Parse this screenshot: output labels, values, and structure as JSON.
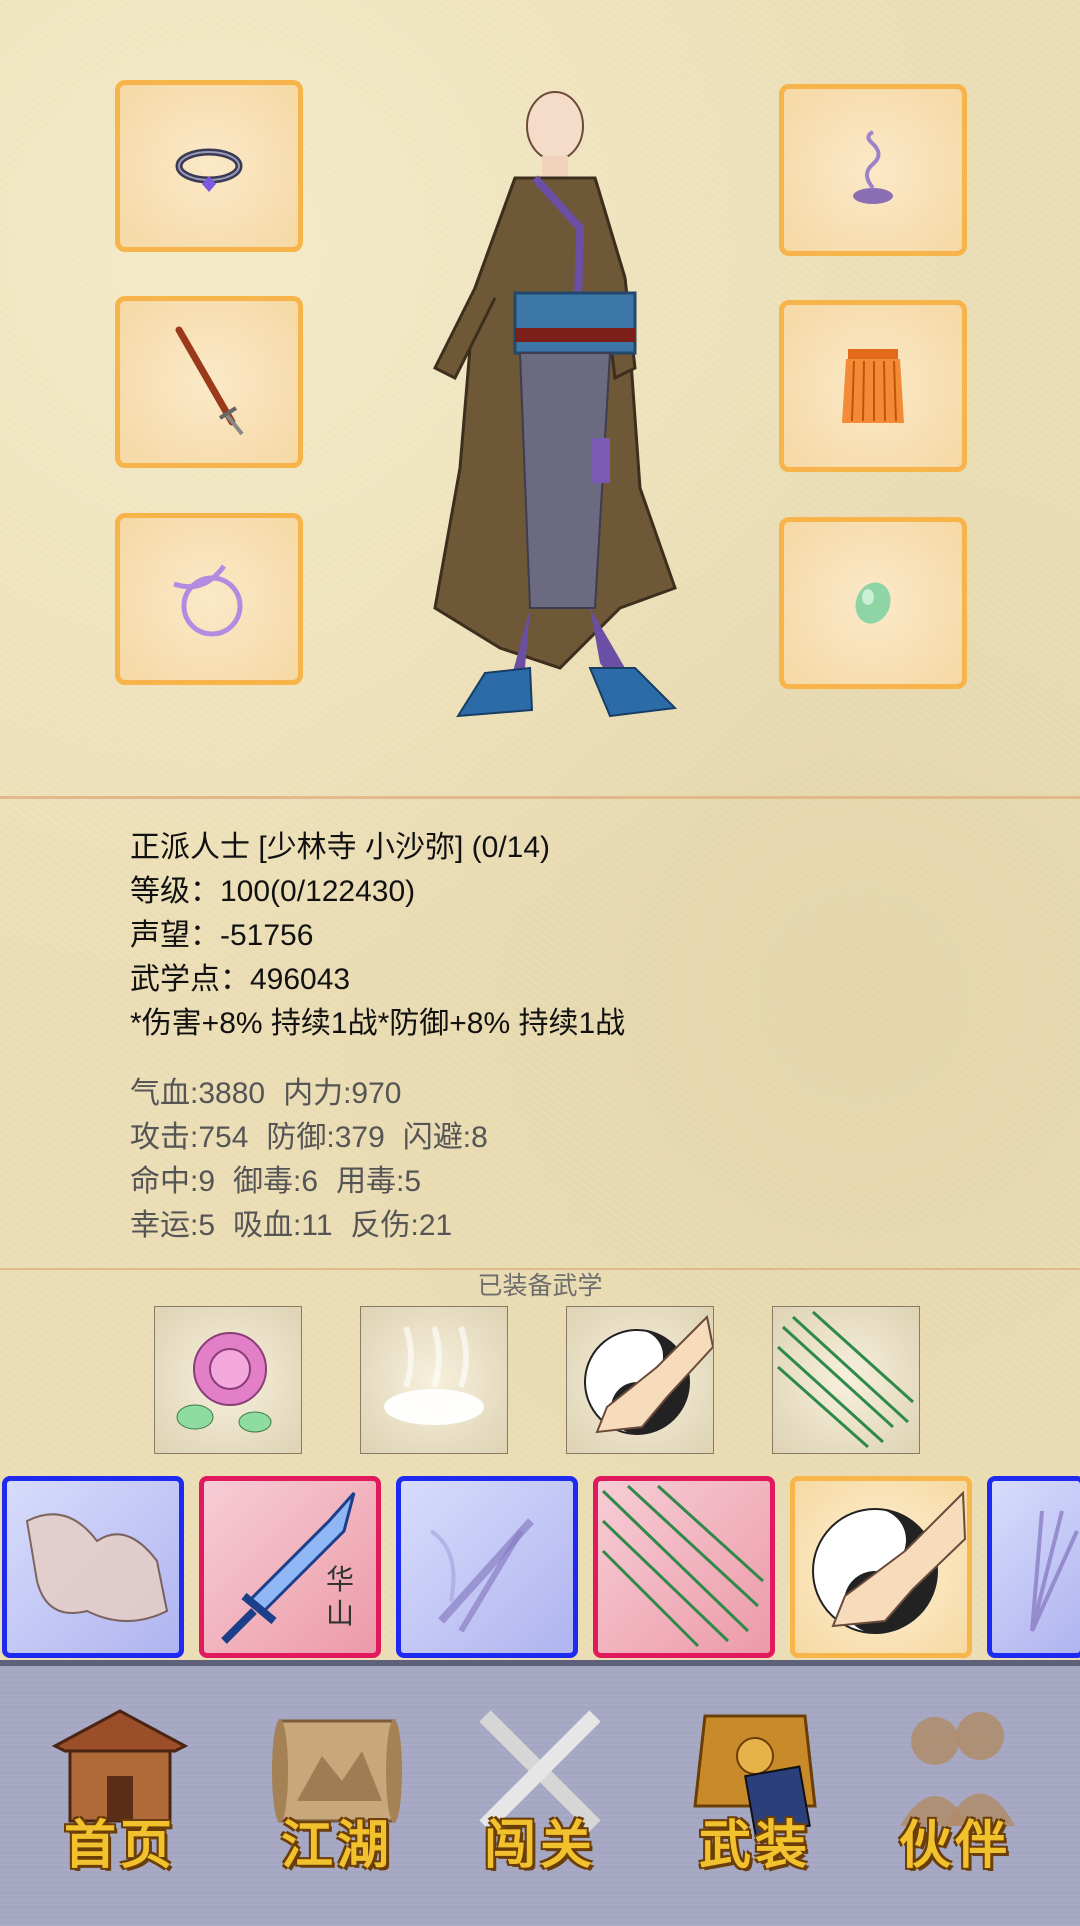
{
  "player": {
    "title_line": "正派人士 [少林寺 小沙弥] (0/14)",
    "level_line": "等级：100(0/122430)",
    "fame_line": "声望：-51756",
    "points_line": "武学点：496043",
    "buff_line": "*伤害+8% 持续1战*防御+8% 持续1战"
  },
  "stats": {
    "hp": "气血:3880",
    "mp": "内力:970",
    "atk": "攻击:754",
    "def": "防御:379",
    "dodge": "闪避:8",
    "hit": "命中:9",
    "poison_res": "御毒:6",
    "poison_use": "用毒:5",
    "luck": "幸运:5",
    "lifesteal": "吸血:11",
    "reflect": "反伤:21"
  },
  "equipped_skills_title": "已装备武学",
  "equipment_slots": [
    "ring-icon",
    "sword-icon",
    "bracelet-icon",
    "incense-icon",
    "armor-icon",
    "jade-icon"
  ],
  "skill_cards": [
    {
      "icon": "fist-icon",
      "frame": "blue"
    },
    {
      "icon": "sword-icon",
      "frame": "red",
      "caption": "华山"
    },
    {
      "icon": "twin-blades-icon",
      "frame": "blue"
    },
    {
      "icon": "needles-icon",
      "frame": "red"
    },
    {
      "icon": "taiji-palm-icon",
      "frame": "orange"
    },
    {
      "icon": "fan-icon",
      "frame": "blue"
    }
  ],
  "nav": {
    "home": "首页",
    "jianghu": "江湖",
    "challenge": "闯关",
    "equip": "武装",
    "partner": "伙伴"
  },
  "colors": {
    "slot_border": "#f6b44a",
    "blue_frame": "#1d2bf0",
    "red_frame": "#e2195c",
    "nav_bg": "#a4a6c2",
    "nav_text": "#f2c12e"
  }
}
